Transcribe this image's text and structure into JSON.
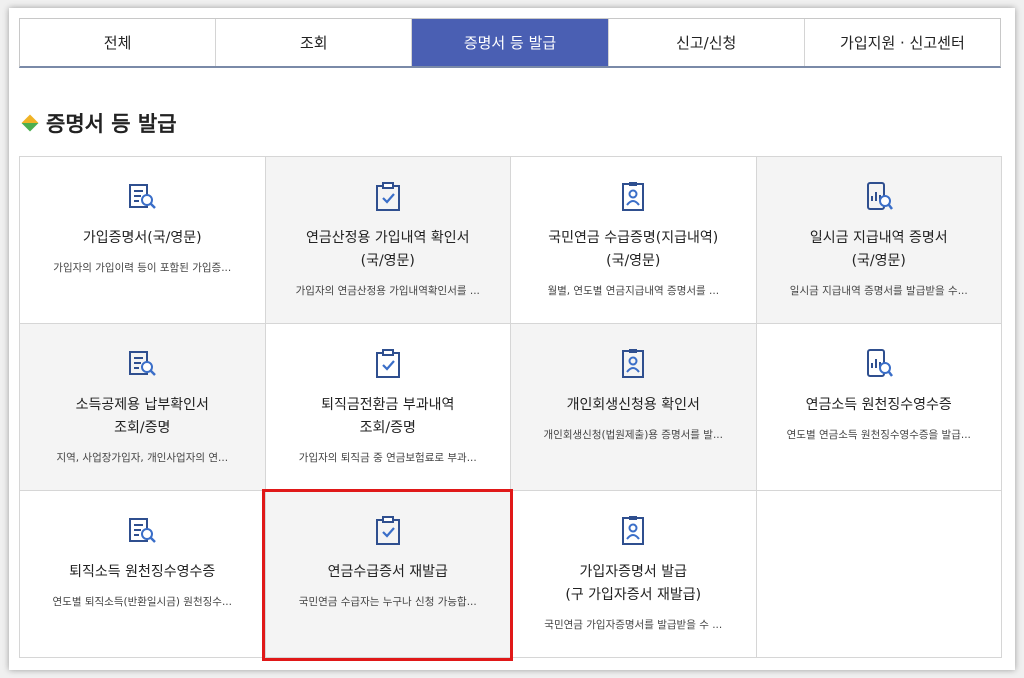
{
  "tabs": [
    {
      "label": "전체",
      "active": false
    },
    {
      "label": "조회",
      "active": false
    },
    {
      "label": "증명서 등 발급",
      "active": true
    },
    {
      "label": "신고/신청",
      "active": false
    },
    {
      "label": "가입지원 · 신고센터",
      "active": false
    }
  ],
  "section": {
    "title": "증명서 등 발급"
  },
  "cards": [
    {
      "icon": "document-search-icon",
      "title": "가입증명서(국/영문)",
      "desc": "가입자의 가입이력 등이 포함된 가입증..."
    },
    {
      "icon": "clipboard-check-icon",
      "title": "연금산정용 가입내역 확인서\n(국/영문)",
      "desc": "가입자의 연금산정용 가입내역확인서를 ..."
    },
    {
      "icon": "id-card-icon",
      "title": "국민연금 수급증명(지급내역)\n(국/영문)",
      "desc": "월별, 연도별 연금지급내역 증명서를 ..."
    },
    {
      "icon": "mobile-search-icon",
      "title": "일시금 지급내역 증명서\n(국/영문)",
      "desc": "일시금 지급내역 증명서를 발급받을 수..."
    },
    {
      "icon": "document-search-icon",
      "title": "소득공제용 납부확인서\n조회/증명",
      "desc": "지역, 사업장가입자, 개인사업자의 연..."
    },
    {
      "icon": "clipboard-check-icon",
      "title": "퇴직금전환금 부과내역\n조회/증명",
      "desc": "가입자의 퇴직금 중 연금보험료로 부과..."
    },
    {
      "icon": "id-card-icon",
      "title": "개인회생신청용 확인서",
      "desc": "개인회생신청(법원제출)용 증명서를 발..."
    },
    {
      "icon": "mobile-search-icon",
      "title": "연금소득 원천징수영수증",
      "desc": "연도별 연금소득 원천징수영수증을 발급..."
    },
    {
      "icon": "document-search-icon",
      "title": "퇴직소득 원천징수영수증",
      "desc": "연도별 퇴직소득(반환일시금) 원천징수..."
    },
    {
      "icon": "clipboard-check-icon",
      "title": "연금수급증서 재발급",
      "desc": "국민연금 수급자는 누구나 신청 가능합..."
    },
    {
      "icon": "id-card-icon",
      "title": "가입자증명서 발급\n(구 가입자증서 재발급)",
      "desc": "국민연금 가입자증명서를 발급받을 수 ..."
    }
  ],
  "colors": {
    "accent": "#4a5fb3",
    "highlight": "#e01818",
    "icon": "#2f4f8f"
  }
}
